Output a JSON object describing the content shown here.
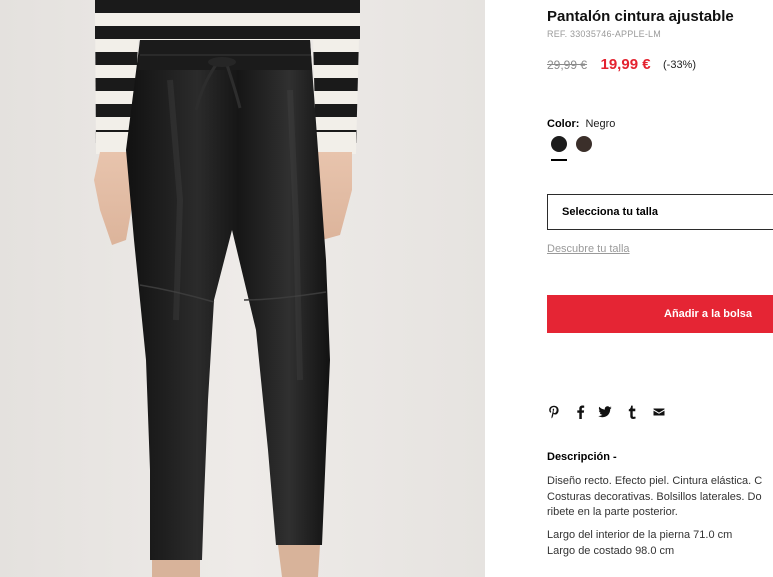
{
  "product": {
    "title": "Pantalón cintura ajustable",
    "reference": "REF. 33035746-APPLE-LM",
    "price_old": "29,99 €",
    "price_new": "19,99 €",
    "discount": "(-33%)"
  },
  "color": {
    "label": "Color:",
    "selected": "Negro",
    "swatches": [
      {
        "name": "Negro",
        "hex": "#1c1c1c",
        "selected": true
      },
      {
        "name": "Marrón",
        "hex": "#3b2f2a",
        "selected": false
      }
    ]
  },
  "size": {
    "select_label": "Selecciona tu talla",
    "guide_link": "Descubre tu talla"
  },
  "actions": {
    "add_to_bag": "Añadir a la bolsa"
  },
  "share": {
    "icons": [
      "pinterest-icon",
      "facebook-icon",
      "twitter-icon",
      "tumblr-icon",
      "email-icon"
    ]
  },
  "description": {
    "title": "Descripción -",
    "lines": [
      "Diseño recto. Efecto piel. Cintura elástica. C",
      "Costuras decorativas. Bolsillos laterales. Do",
      "ribete en la parte posterior."
    ],
    "measures": [
      "Largo del interior de la pierna 71.0 cm",
      "Largo de costado 98.0 cm"
    ]
  },
  "colors": {
    "accent": "#e52534",
    "price_sale": "#e4222f",
    "text_muted": "#9a9a9a"
  }
}
